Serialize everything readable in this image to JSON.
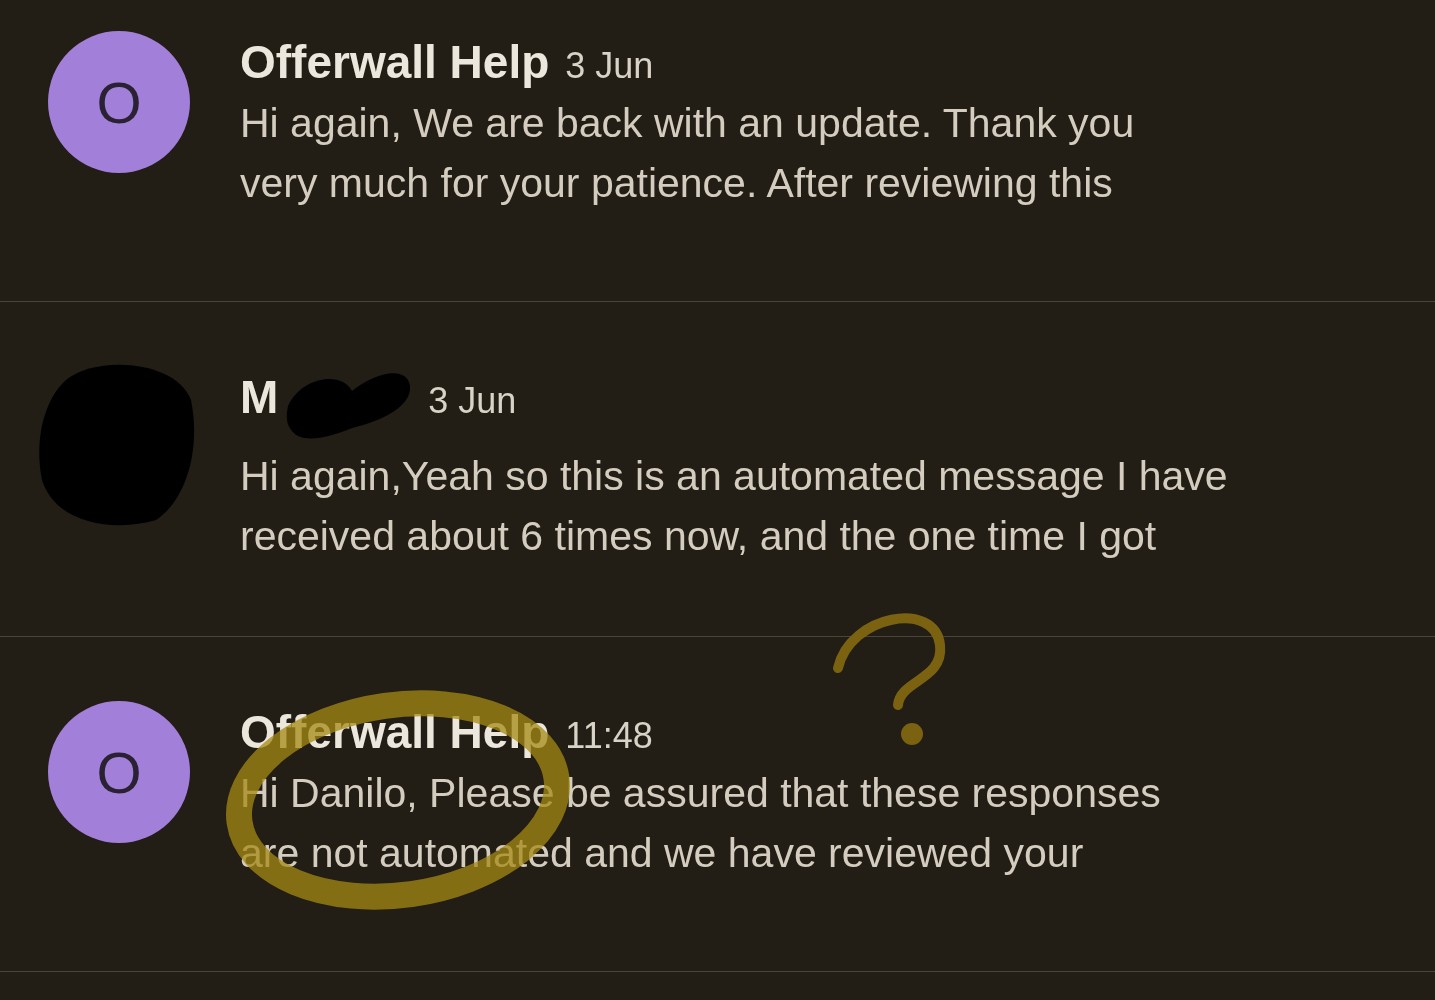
{
  "messages": [
    {
      "sender": "Offerwall Help",
      "time": "3 Jun",
      "avatar_letter": "O",
      "preview_lines": [
        "Hi again, We are back with an update. Thank you",
        "very much for your patience. After reviewing this"
      ]
    },
    {
      "sender": "M",
      "time": "3 Jun",
      "redacted": true,
      "preview_lines": [
        "Hi again,Yeah so this is an automated message I have",
        "received about 6 times now, and the one time I got"
      ]
    },
    {
      "sender": "Offerwall Help",
      "time": "11:48",
      "avatar_letter": "O",
      "preview_lines": [
        "Hi Danilo, Please be assured that these responses",
        "are not automated and we have reviewed your"
      ]
    }
  ],
  "annotations": {
    "question_mark": true,
    "circle": true
  }
}
